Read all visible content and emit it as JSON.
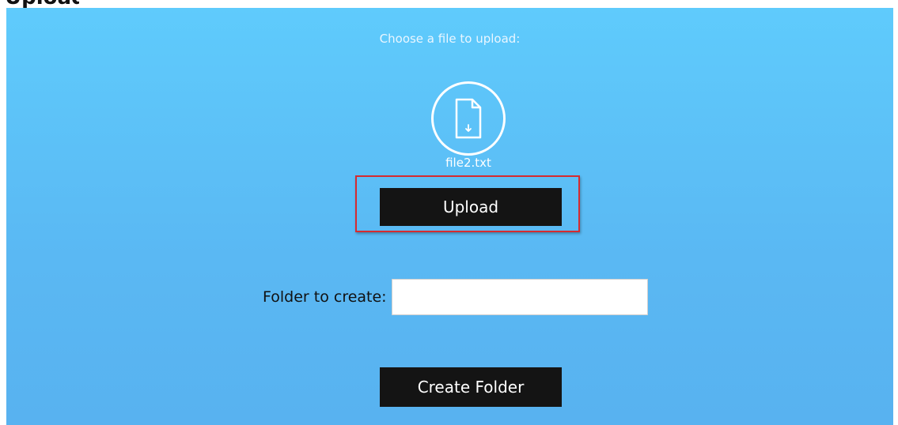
{
  "page": {
    "heading": "Upload"
  },
  "upload": {
    "prompt": "Choose a file to upload:",
    "file_icon": "file-download-icon",
    "selected_file": "file2.txt",
    "button_label": "Upload"
  },
  "folder": {
    "label": "Folder to create:",
    "input_value": "",
    "button_label": "Create Folder"
  },
  "colors": {
    "panel_top": "#5fcbfc",
    "panel_bottom": "#58b2f0",
    "button_bg": "#141414",
    "highlight_border": "#d62b30"
  }
}
